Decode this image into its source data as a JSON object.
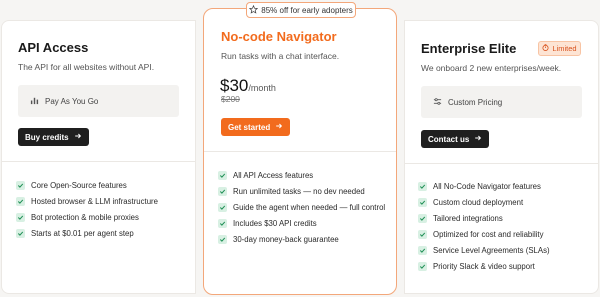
{
  "badge_top": "85% off for early adopters",
  "plans": [
    {
      "title": "API Access",
      "description": "The API for all websites without API.",
      "info_label": "Pay As You Go",
      "button_label": "Buy credits",
      "features": [
        "Core Open-Source features",
        "Hosted browser & LLM infrastructure",
        "Bot protection & mobile proxies",
        "Starts at $0.01 per agent step"
      ]
    },
    {
      "title": "No-code Navigator",
      "description": "Run tasks with a chat interface.",
      "price": "$30",
      "price_unit": "/month",
      "old_price": "$200",
      "button_label": "Get started",
      "features": [
        "All API Access features",
        "Run unlimited tasks — no dev needed",
        "Guide the agent when needed — full control",
        "Includes $30 API credits",
        "30-day money-back guarantee"
      ]
    },
    {
      "title": "Enterprise Elite",
      "badge": "Limited",
      "description": "We onboard 2 new enterprises/week.",
      "info_label": "Custom Pricing",
      "button_label": "Contact us",
      "features": [
        "All No-Code Navigator features",
        "Custom cloud deployment",
        "Tailored integrations",
        "Optimized for cost and reliability",
        "Service Level Agreements (SLAs)",
        "Priority Slack & video support"
      ]
    }
  ],
  "colors": {
    "accent": "#f26b1d",
    "check_bg": "#d8f0e3",
    "check_mark": "#1f8f55"
  }
}
